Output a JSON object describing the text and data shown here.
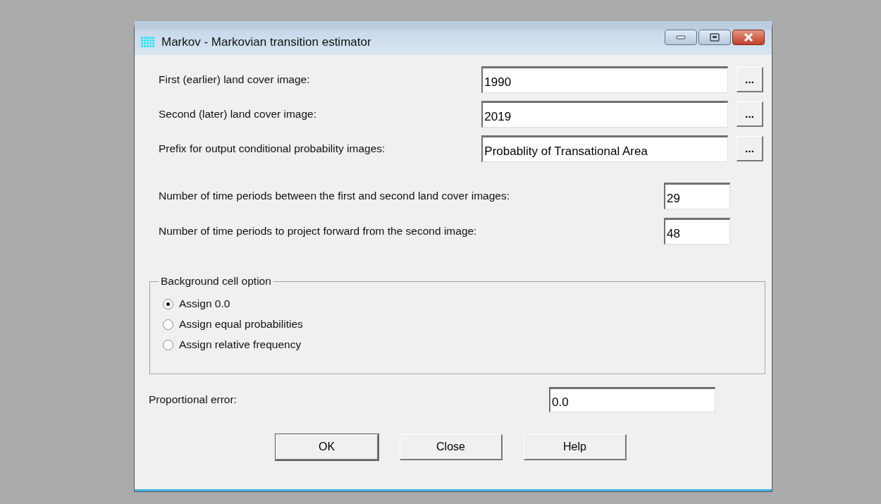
{
  "window": {
    "title": "Markov - Markovian transition estimator"
  },
  "image_fields": [
    {
      "label": "First (earlier) land cover image:",
      "value": "1990",
      "browse": "..."
    },
    {
      "label": "Second (later) land cover image:",
      "value": "2019",
      "browse": "..."
    },
    {
      "label": "Prefix for output conditional probability images:",
      "value": "Probablity of Transational Area",
      "browse": "..."
    }
  ],
  "period_fields": [
    {
      "label": "Number of time periods between the first and second land cover images:",
      "value": "29"
    },
    {
      "label": "Number of time periods to project forward from the second image:",
      "value": "48"
    }
  ],
  "background_option": {
    "title": "Background cell option",
    "options": [
      {
        "label": "Assign 0.0",
        "selected": true
      },
      {
        "label": "Assign equal probabilities",
        "selected": false
      },
      {
        "label": "Assign relative frequency",
        "selected": false
      }
    ]
  },
  "proportional_error": {
    "label": "Proportional error:",
    "value": "0.0"
  },
  "buttons": [
    "OK",
    "Close",
    "Help"
  ]
}
